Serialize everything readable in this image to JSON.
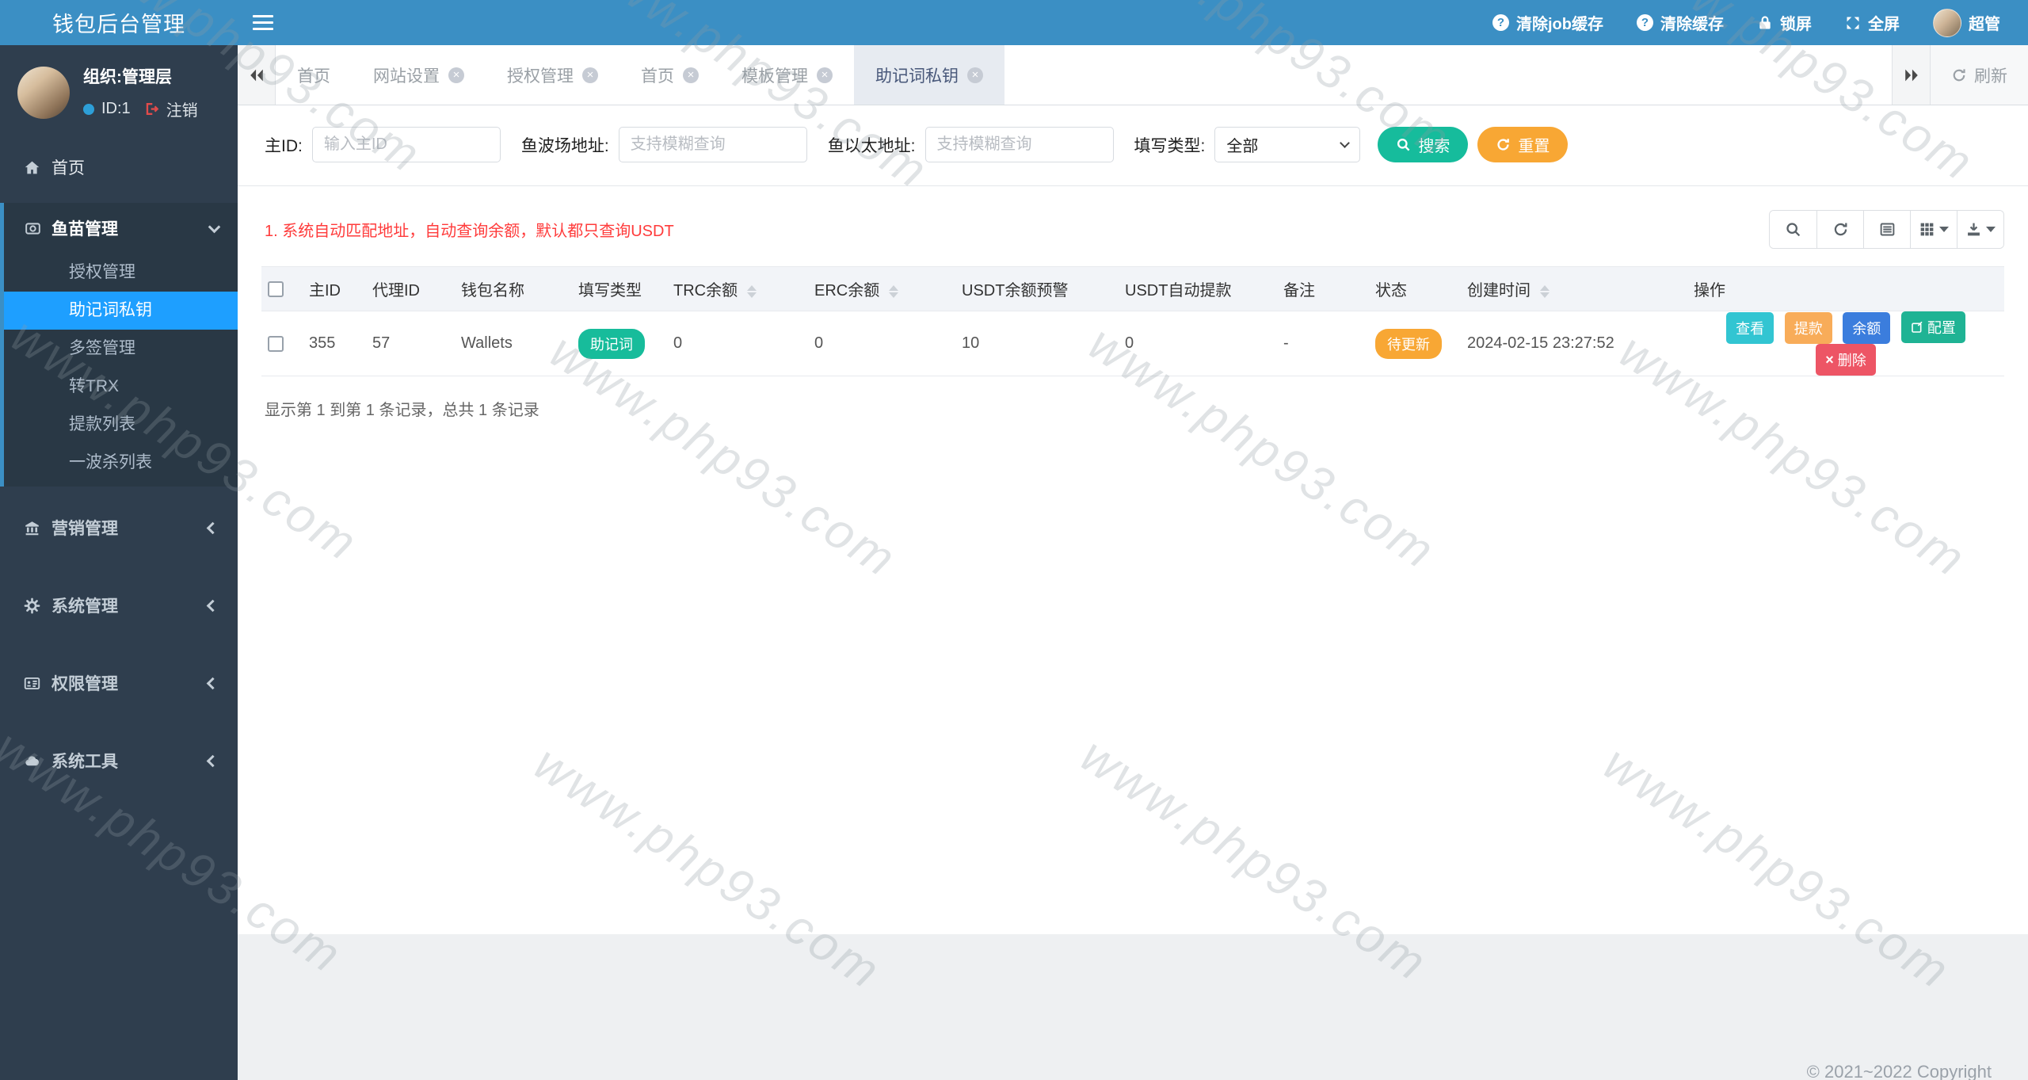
{
  "watermark": {
    "text": "www.php93.com"
  },
  "colors": {
    "header_blue": "#3b8fc4",
    "sidebar_dark": "#2f3e4e",
    "active_menu_blue": "#1e9fff",
    "success_green": "#16bc9c",
    "warning_orange": "#f8a734",
    "info_teal": "#32c5d2",
    "primary_blue": "#3b7ddd",
    "danger_red": "#ed5565",
    "notice_red": "#ff3b3b"
  },
  "header": {
    "title": "钱包后台管理",
    "clear_job_cache": "清除job缓存",
    "clear_cache": "清除缓存",
    "lock_screen": "锁屏",
    "fullscreen": "全屏",
    "user_name": "超管"
  },
  "sidebar": {
    "org": "组织:管理层",
    "user_id": "ID:1",
    "logout": "注销",
    "home": "首页",
    "fish_section": {
      "label": "鱼苗管理",
      "items": [
        {
          "label": "授权管理"
        },
        {
          "label": "助记词私钥"
        },
        {
          "label": "多签管理"
        },
        {
          "label": "转TRX"
        },
        {
          "label": "提款列表"
        },
        {
          "label": "一波杀列表"
        }
      ]
    },
    "sections": [
      {
        "label": "营销管理"
      },
      {
        "label": "系统管理"
      },
      {
        "label": "权限管理"
      },
      {
        "label": "系统工具"
      }
    ]
  },
  "tabbar": {
    "tabs": [
      {
        "label": "首页"
      },
      {
        "label": "网站设置"
      },
      {
        "label": "授权管理"
      },
      {
        "label": "首页"
      },
      {
        "label": "模板管理"
      },
      {
        "label": "助记词私钥"
      }
    ],
    "refresh": "刷新"
  },
  "filters": {
    "main_id": {
      "label": "主ID:",
      "placeholder": "输入主ID"
    },
    "tron_address": {
      "label": "鱼波场地址:",
      "placeholder": "支持模糊查询"
    },
    "eth_address": {
      "label": "鱼以太地址:",
      "placeholder": "支持模糊查询"
    },
    "fill_type": {
      "label": "填写类型:",
      "value": "全部"
    },
    "search": "搜索",
    "reset": "重置"
  },
  "notice": "1. 系统自动匹配地址，自动查询余额，默认都只查询USDT",
  "table": {
    "columns": [
      "主ID",
      "代理ID",
      "钱包名称",
      "填写类型",
      "TRC余额",
      "ERC余额",
      "USDT余额预警",
      "USDT自动提款",
      "备注",
      "状态",
      "创建时间",
      "操作"
    ],
    "rows": [
      {
        "main_id": "355",
        "agent_id": "57",
        "wallet_name": "Wallets",
        "fill_type": "助记词",
        "trc_balance": "0",
        "erc_balance": "0",
        "usdt_warning": "10",
        "usdt_auto": "0",
        "remark": "-",
        "status": "待更新",
        "created_at": "2024-02-15 23:27:52"
      }
    ],
    "row_actions": {
      "view": "查看",
      "withdraw": "提款",
      "balance": "余额",
      "config": "配置",
      "delete": "删除"
    },
    "summary": "显示第 1 到第 1 条记录，总共 1 条记录"
  },
  "footer": "© 2021~2022 Copyright"
}
